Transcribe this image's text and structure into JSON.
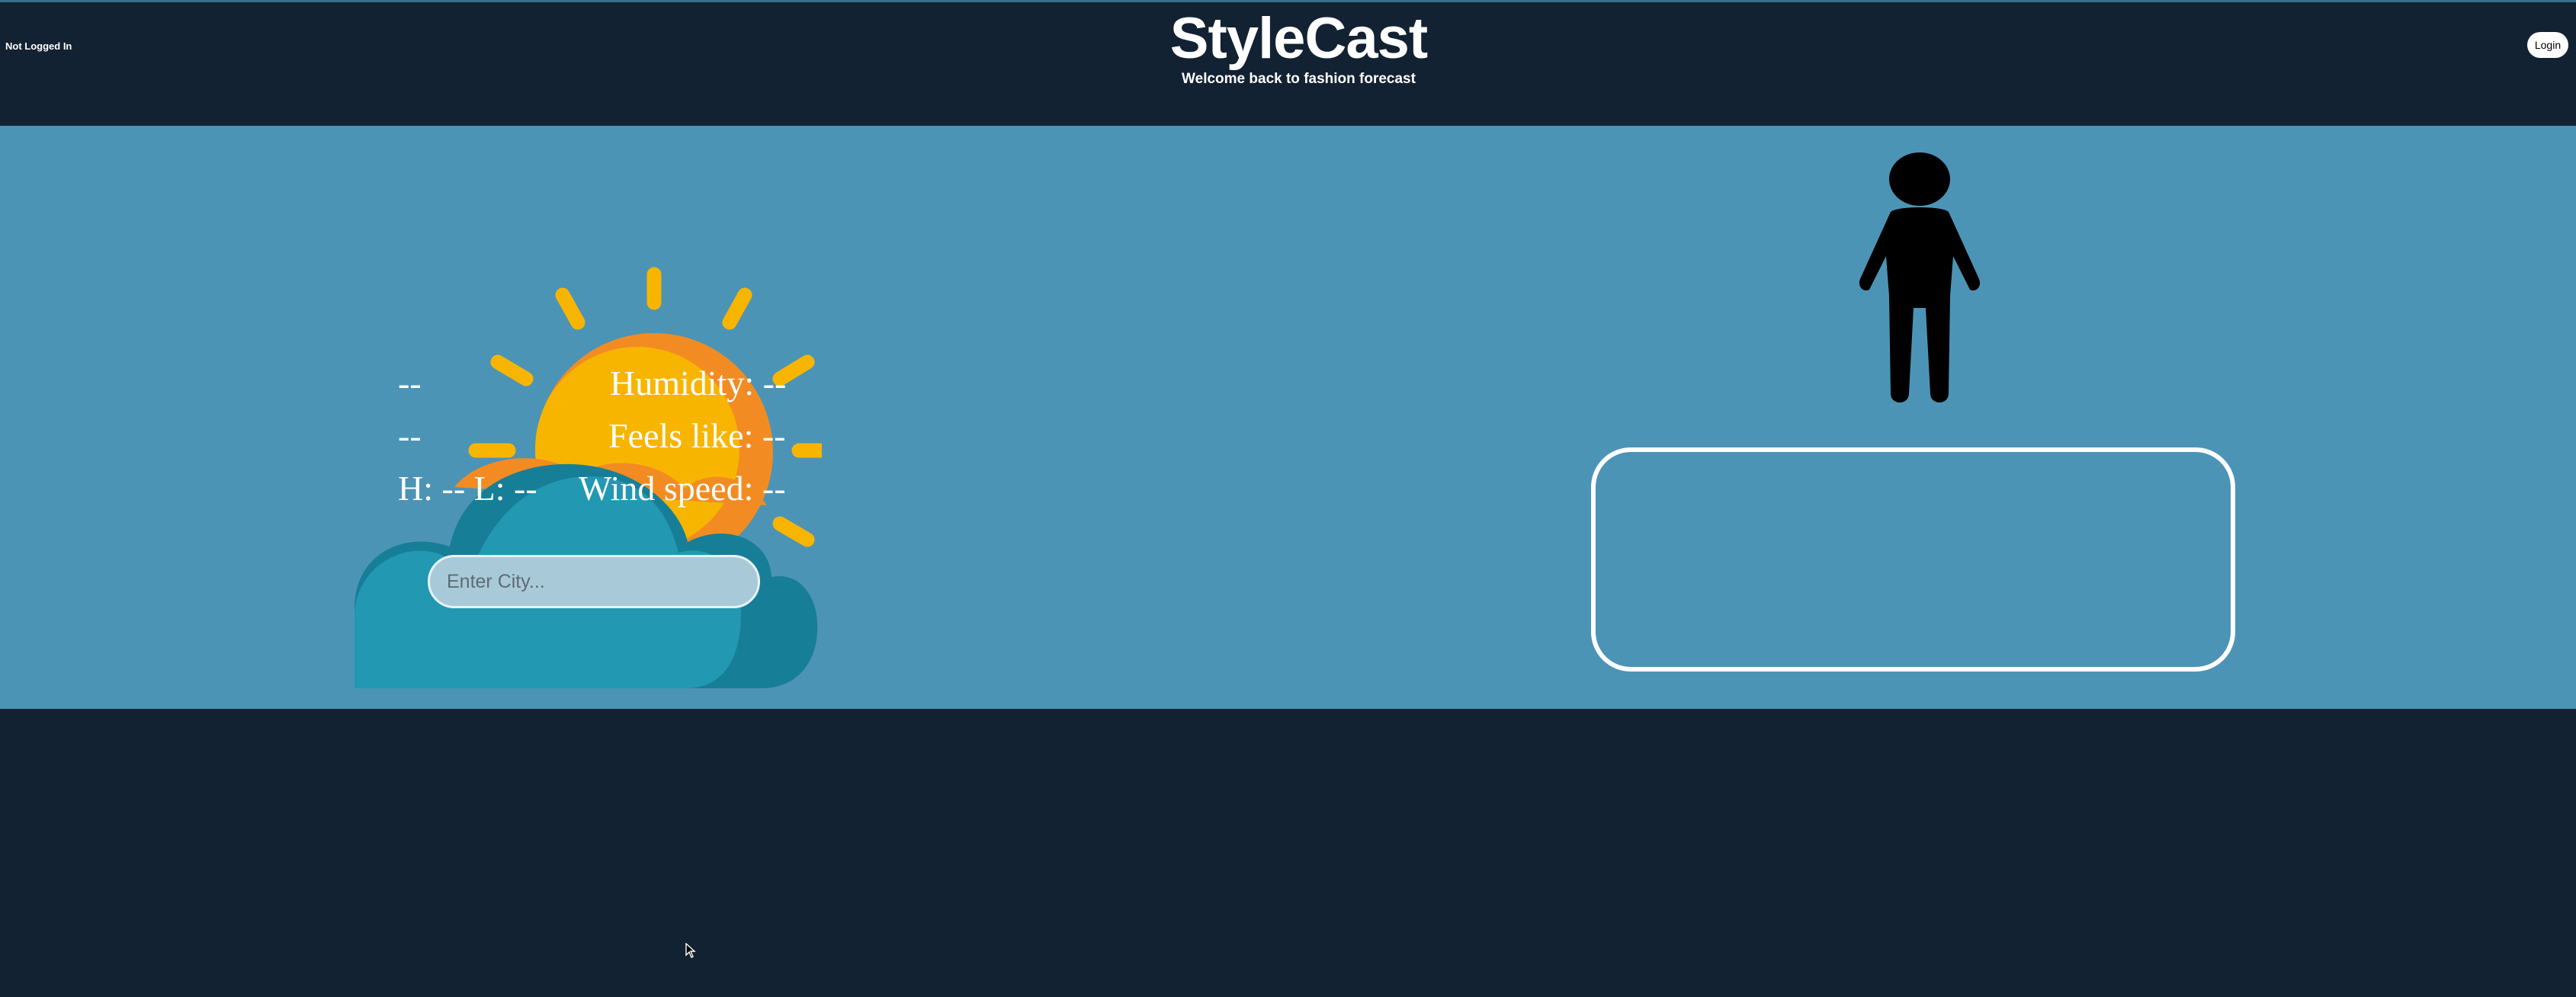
{
  "header": {
    "login_status": "Not Logged In",
    "title": "StyleCast",
    "subtitle": "Welcome back to fashion forecast",
    "login_label": "Login"
  },
  "weather": {
    "icon": "partly-cloudy-icon",
    "line1_left": "--",
    "line1_right": "Humidity: --",
    "line2_left": "--",
    "line2_right": "Feels like: --",
    "line3_left": "H: -- L: --",
    "line3_right": "Wind speed: --",
    "city_placeholder": "Enter City...",
    "city_value": ""
  },
  "outfit": {
    "figure_icon": "person-icon",
    "suggestion_text": ""
  },
  "colors": {
    "page_background": "#122232",
    "main_background": "#4c94b6",
    "sun": "#f7b500",
    "sun_shade": "#f28c22",
    "cloud": "#2298b3",
    "cloud_shade": "#177e98",
    "text": "#ffffff"
  }
}
